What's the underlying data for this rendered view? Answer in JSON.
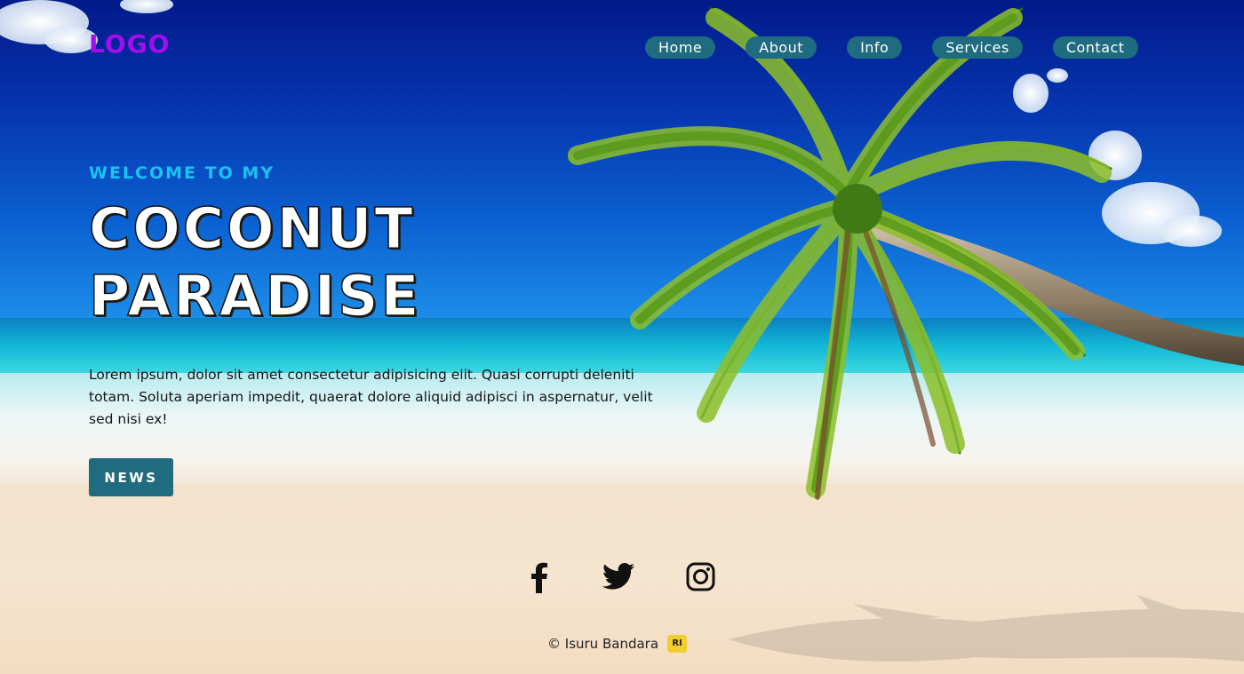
{
  "header": {
    "logo": "LOGO",
    "nav": [
      "Home",
      "About",
      "Info",
      "Services",
      "Contact"
    ]
  },
  "hero": {
    "eyebrow": "WELCOME TO MY",
    "title_line1": "COCONUT",
    "title_line2": "PARADISE",
    "paragraph": "Lorem ipsum, dolor sit amet consectetur adipisicing elit. Quasi corrupti deleniti totam. Soluta aperiam impedit, quaerat dolore aliquid adipisci in aspernatur, velit sed nisi ex!",
    "button": "NEWS"
  },
  "social": {
    "icons": [
      "facebook-icon",
      "twitter-icon",
      "instagram-icon"
    ]
  },
  "footer": {
    "copyright": "© Isuru Bandara",
    "badge": "RI"
  },
  "colors": {
    "accent": "#1f6b80",
    "logo": "#a20df0",
    "eyebrow": "#1cc2f2"
  }
}
